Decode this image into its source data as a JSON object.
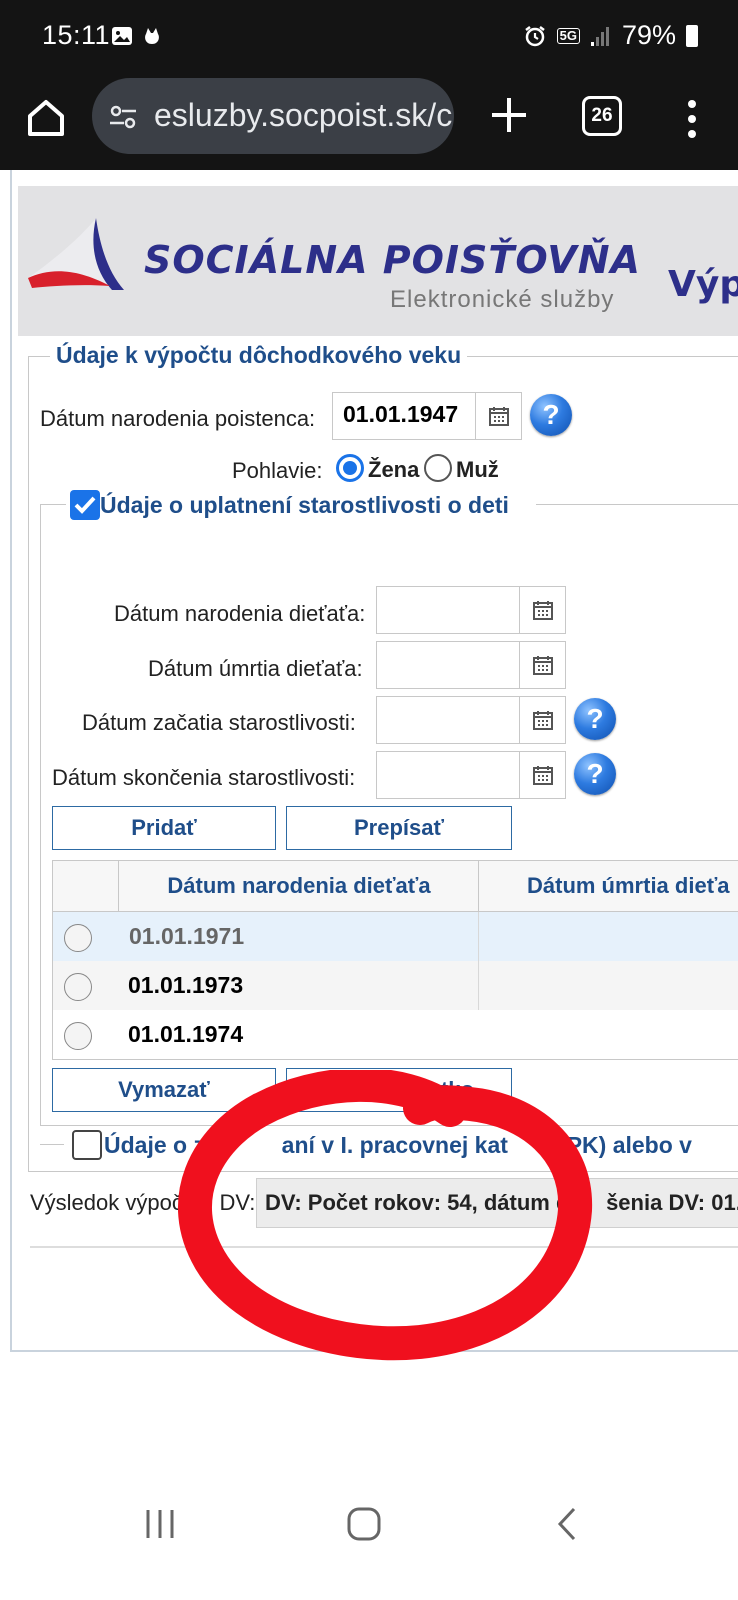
{
  "status_bar": {
    "time": "15:11",
    "network": "5G",
    "battery": "79%",
    "icons": [
      "image-icon",
      "cat-icon",
      "alarm-icon",
      "network-5g-icon",
      "signal-icon",
      "battery-icon"
    ]
  },
  "browser": {
    "url": "esluzby.socpoist.sk/c",
    "tab_count": "26"
  },
  "header": {
    "logo_title": "SOCIÁLNA POISŤOVŇA",
    "logo_subtitle": "Elektronické služby",
    "page_title_partial": "Výpo"
  },
  "form": {
    "section_title": "Údaje k výpočtu dôchodkového veku",
    "birth_date_label": "Dátum narodenia poistenca:",
    "birth_date_value": "01.01.1947",
    "gender_label": "Pohlavie:",
    "gender_options": [
      "Žena",
      "Muž"
    ],
    "gender_selected": "Žena",
    "children_section": {
      "title": "Údaje o uplatnení starostlivosti o deti",
      "checked": true,
      "child_birth_label": "Dátum narodenia dieťaťa:",
      "child_death_label": "Dátum úmrtia dieťaťa:",
      "care_start_label": "Dátum začatia starostlivosti:",
      "care_end_label": "Dátum skončenia starostlivosti:",
      "add_button": "Pridať",
      "overwrite_button": "Prepísať",
      "table": {
        "headers": [
          "Dátum narodenia dieťaťa",
          "Dátum úmrtia dieťa"
        ],
        "rows": [
          {
            "birth": "01.01.1971",
            "death": ""
          },
          {
            "birth": "01.01.1973",
            "death": ""
          },
          {
            "birth": "01.01.1974",
            "death": ""
          }
        ]
      },
      "delete_button": "Vymazať",
      "second_button_partial": "Vy          ečatko"
    },
    "category_section": {
      "title": "Údaje o za          aní v I. pracovnej kat        (PK) alebo v",
      "checked": false
    },
    "result_label": "Výsledok výpoč      DV:",
    "result_value": "DV: Počet rokov: 54, dátum d      šenia DV: 01."
  },
  "annotation": {
    "color": "#f0101e"
  }
}
